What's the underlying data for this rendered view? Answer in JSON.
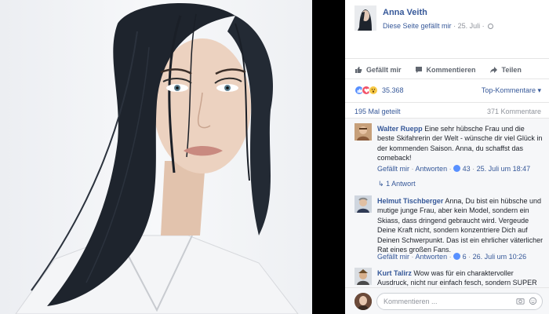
{
  "post": {
    "page_name": "Anna Veith",
    "like_page_label": "Diese Seite gefällt mir",
    "separator": "·",
    "date": "25. Juli",
    "date_separator": "·"
  },
  "actions": {
    "like": "Gefällt mir",
    "comment": "Kommentieren",
    "share": "Teilen"
  },
  "stats": {
    "reactions_count": "35.368",
    "top_comments": "Top-Kommentare",
    "shares": "195 Mal geteilt",
    "comments_count": "371 Kommentare"
  },
  "comments": [
    {
      "author": "Walter Ruepp",
      "text": "Eine sehr hübsche Frau und die beste Skifahrerin der Welt - wünsche dir viel Glück in der kommenden Saison. Anna, du schaffst das comeback!",
      "like": "Gefällt mir",
      "reply": "Antworten",
      "likes": "43",
      "time": "25. Juli um 18:47",
      "replies": "1 Antwort"
    },
    {
      "author": "Helmut Tischberger",
      "text": "Anna, Du bist ein hübsche und mutige junge Frau, aber kein Model, sondern ein Skiass, dass dringend gebraucht wird. Vergeude Deine Kraft nicht, sondern konzentriere Dich auf Deinen Schwerpunkt. Das ist ein ehrlicher väterlicher Rat eines großen Fans.",
      "like": "Gefällt mir",
      "reply": "Antworten",
      "likes": "6",
      "time": "26. Juli um 10:26"
    },
    {
      "author": "Kurt Talirz",
      "text": "Wow was für ein charaktervoller Ausdruck, nicht nur einfach fesch, sondern SUPER"
    }
  ],
  "composer": {
    "placeholder": "Kommentieren ..."
  },
  "colors": {
    "link": "#365899",
    "meta": "#90949c",
    "like_blue": "#5890ff",
    "love_red": "#f25268"
  }
}
